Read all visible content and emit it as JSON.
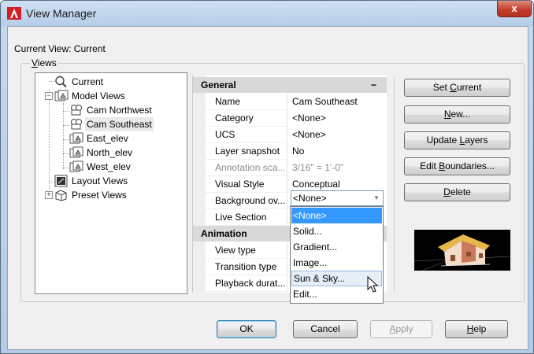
{
  "window": {
    "title": "View Manager",
    "close_label": "x"
  },
  "current_view_label": "Current View: Current",
  "views_group": {
    "prefix": "",
    "underlined": "V",
    "rest": "iews"
  },
  "tree": {
    "current": "Current",
    "model_views": "Model Views",
    "children": [
      "Cam Northwest",
      "Cam Southeast",
      "East_elev",
      "North_elev",
      "West_elev"
    ],
    "layout_views": "Layout Views",
    "preset_views": "Preset Views",
    "expand_symbols": {
      "collapsed": "+",
      "expanded": "−"
    }
  },
  "properties": {
    "general_header": "General",
    "animation_header": "Animation",
    "collapse_symbol": "−",
    "general_rows": [
      {
        "key": "Name",
        "value": "Cam Southeast"
      },
      {
        "key": "Category",
        "value": "<None>"
      },
      {
        "key": "UCS",
        "value": "<None>"
      },
      {
        "key": "Layer snapshot",
        "value": "No"
      },
      {
        "key": "Annotation sca...",
        "value": "3/16\" = 1'-0\""
      },
      {
        "key": "Visual Style",
        "value": "Conceptual"
      },
      {
        "key": "Background ov...",
        "value": "<None>"
      },
      {
        "key": "Live Section",
        "value": ""
      }
    ],
    "animation_rows": [
      {
        "key": "View type",
        "value": ""
      },
      {
        "key": "Transition type",
        "value": ""
      },
      {
        "key": "Playback durat...",
        "value": ""
      }
    ]
  },
  "background_combo": {
    "value": "<None>",
    "arrow": "▼",
    "options": [
      "<None>",
      "Solid...",
      "Gradient...",
      "Image...",
      "Sun & Sky...",
      "Edit..."
    ],
    "selected_index": 0,
    "hover_index": 4
  },
  "buttons": {
    "set_current": {
      "pre": "Set ",
      "u": "C",
      "post": "urrent"
    },
    "new": {
      "pre": "",
      "u": "N",
      "post": "ew..."
    },
    "update_layers": {
      "pre": "Update ",
      "u": "L",
      "post": "ayers"
    },
    "edit_boundaries": {
      "pre": "Edit ",
      "u": "B",
      "post": "oundaries..."
    },
    "delete": {
      "pre": "",
      "u": "D",
      "post": "elete"
    },
    "ok": "OK",
    "cancel": "Cancel",
    "apply": {
      "pre": "",
      "u": "A",
      "post": "pply"
    },
    "help": {
      "pre": "",
      "u": "H",
      "post": "elp"
    }
  },
  "colors": {
    "selection": "#3399ff",
    "close": "#c33f2d",
    "titlebar": "#b6cde8"
  }
}
